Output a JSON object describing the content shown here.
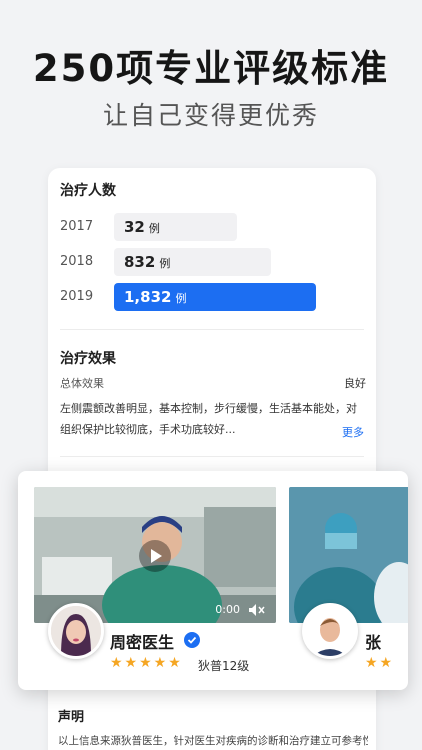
{
  "hero": {
    "title": "250项专业评级标准",
    "subtitle": "让自己变得更优秀"
  },
  "treatment_count": {
    "title": "治疗人数",
    "unit": "例",
    "rows": [
      {
        "year": "2017",
        "count": "32"
      },
      {
        "year": "2018",
        "count": "832"
      },
      {
        "year": "2019",
        "count": "1,832"
      }
    ]
  },
  "treatment_effect": {
    "title": "治疗效果",
    "overall_label": "总体效果",
    "overall_value": "良好",
    "description_line1": "左侧震颤改善明显，基本控制，步行缓慢，生活基本能处，对",
    "description_line2": "组织保护比较彻底，手术功底较好...",
    "more_label": "更多"
  },
  "doctors": [
    {
      "name": "周密医生",
      "level": "狄普12级",
      "stars": "★★★★★",
      "video_time": "0:00"
    },
    {
      "name": "张",
      "stars": "★★"
    }
  ],
  "declaration": {
    "title": "声明",
    "text": "以上信息来源狄普医生，针对医生对疾病的诊断和治疗建立可参考性"
  },
  "colors": {
    "accent": "#1c6ef2",
    "star": "#f5a623"
  },
  "icons": [
    "play-icon",
    "mute-icon",
    "verified-badge-icon"
  ]
}
